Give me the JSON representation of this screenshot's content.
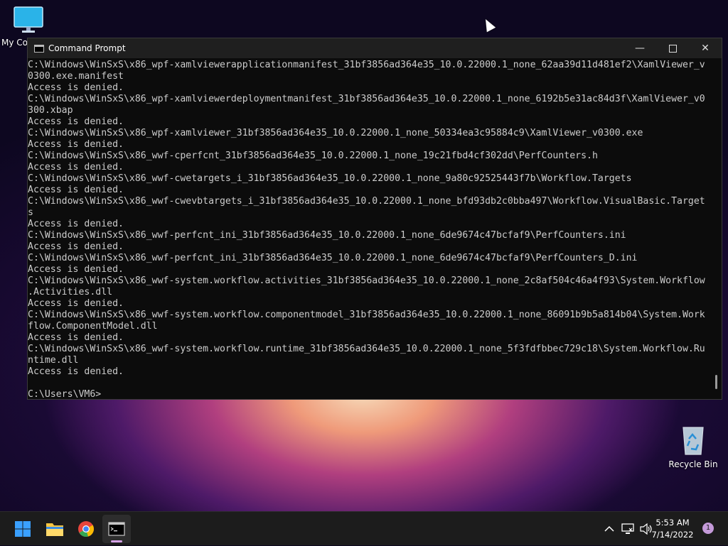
{
  "desktop": {
    "icons": [
      {
        "label": "My Computer"
      },
      {
        "label": "Recycle Bin"
      }
    ]
  },
  "window": {
    "title": "Command Prompt",
    "icon": "cmd-icon",
    "controls": [
      "minimize-icon",
      "maximize-icon",
      "close-icon"
    ]
  },
  "console": {
    "lines": [
      "C:\\Windows\\WinSxS\\x86_wpf-xamlviewerapplicationmanifest_31bf3856ad364e35_10.0.22000.1_none_62aa39d11d481ef2\\XamlViewer_v",
      "0300.exe.manifest",
      "Access is denied.",
      "C:\\Windows\\WinSxS\\x86_wpf-xamlviewerdeploymentmanifest_31bf3856ad364e35_10.0.22000.1_none_6192b5e31ac84d3f\\XamlViewer_v0",
      "300.xbap",
      "Access is denied.",
      "C:\\Windows\\WinSxS\\x86_wpf-xamlviewer_31bf3856ad364e35_10.0.22000.1_none_50334ea3c95884c9\\XamlViewer_v0300.exe",
      "Access is denied.",
      "C:\\Windows\\WinSxS\\x86_wwf-cperfcnt_31bf3856ad364e35_10.0.22000.1_none_19c21fbd4cf302dd\\PerfCounters.h",
      "Access is denied.",
      "C:\\Windows\\WinSxS\\x86_wwf-cwetargets_i_31bf3856ad364e35_10.0.22000.1_none_9a80c92525443f7b\\Workflow.Targets",
      "Access is denied.",
      "C:\\Windows\\WinSxS\\x86_wwf-cwevbtargets_i_31bf3856ad364e35_10.0.22000.1_none_bfd93db2c0bba497\\Workflow.VisualBasic.Target",
      "s",
      "Access is denied.",
      "C:\\Windows\\WinSxS\\x86_wwf-perfcnt_ini_31bf3856ad364e35_10.0.22000.1_none_6de9674c47bcfaf9\\PerfCounters.ini",
      "Access is denied.",
      "C:\\Windows\\WinSxS\\x86_wwf-perfcnt_ini_31bf3856ad364e35_10.0.22000.1_none_6de9674c47bcfaf9\\PerfCounters_D.ini",
      "Access is denied.",
      "C:\\Windows\\WinSxS\\x86_wwf-system.workflow.activities_31bf3856ad364e35_10.0.22000.1_none_2c8af504c46a4f93\\System.Workflow",
      ".Activities.dll",
      "Access is denied.",
      "C:\\Windows\\WinSxS\\x86_wwf-system.workflow.componentmodel_31bf3856ad364e35_10.0.22000.1_none_86091b9b5a814b04\\System.Work",
      "flow.ComponentModel.dll",
      "Access is denied.",
      "C:\\Windows\\WinSxS\\x86_wwf-system.workflow.runtime_31bf3856ad364e35_10.0.22000.1_none_5f3fdfbbec729c18\\System.Workflow.Ru",
      "ntime.dll",
      "Access is denied.",
      "",
      "C:\\Users\\VM6>"
    ]
  },
  "taskbar": {
    "apps": [
      {
        "name": "start-icon"
      },
      {
        "name": "file-explorer-icon"
      },
      {
        "name": "chrome-icon"
      },
      {
        "name": "command-prompt-icon"
      }
    ],
    "tray": {
      "icons": [
        "chevron-up-icon",
        "network-icon",
        "volume-icon"
      ],
      "time": "5:53 AM",
      "date": "7/14/2022",
      "notification_count": "1"
    }
  },
  "colors": {
    "console_bg": "#0c0c0c",
    "console_text": "#cccccc",
    "taskbar_bg": "#1c1c1c",
    "accent": "#c49ad9"
  }
}
